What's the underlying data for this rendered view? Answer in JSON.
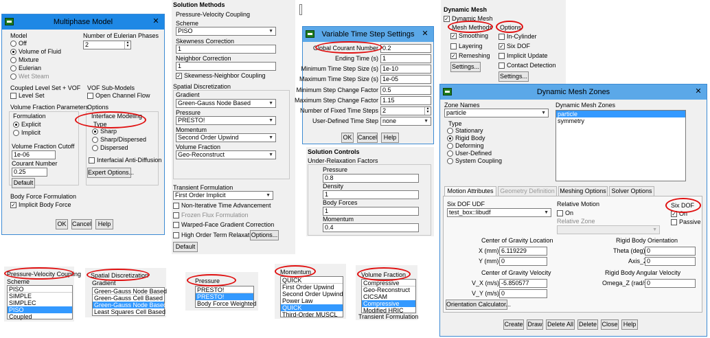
{
  "multiphase": {
    "title": "Multiphase Model",
    "model_label": "Model",
    "models": [
      "Off",
      "Volume of Fluid",
      "Mixture",
      "Eulerian",
      "Wet Steam"
    ],
    "num_phases_label": "Number of Eulerian Phases",
    "num_phases_value": "2",
    "coupled_label": "Coupled Level Set + VOF",
    "level_set": "Level Set",
    "vof_sub_label": "VOF Sub-Models",
    "open_channel": "Open Channel Flow",
    "vf_params_label": "Volume Fraction Parameters",
    "formulation_label": "Formulation",
    "explicit": "Explicit",
    "implicit": "Implicit",
    "options_label": "Options",
    "interface_modeling": "Interface Modeling",
    "type_label": "Type",
    "sharp": "Sharp",
    "sharp_dispersed": "Sharp/Dispersed",
    "dispersed": "Dispersed",
    "anti_diffusion": "Interfacial Anti-Diffusion",
    "cutoff_label": "Volume Fraction Cutoff",
    "cutoff_value": "1e-06",
    "courant_label": "Courant Number",
    "courant_value": "0.25",
    "default_btn": "Default",
    "expert_btn": "Expert Options...",
    "body_force_label": "Body Force Formulation",
    "implicit_body_force": "Implicit Body Force",
    "ok": "OK",
    "cancel": "Cancel",
    "help": "Help"
  },
  "solution_methods": {
    "title": "Solution Methods",
    "pv_coupling": "Pressure-Velocity Coupling",
    "scheme_label": "Scheme",
    "scheme_value": "PISO",
    "skewness_label": "Skewness Correction",
    "skewness_value": "1",
    "neighbor_label": "Neighbor Correction",
    "neighbor_value": "1",
    "skew_neighbor": "Skewness-Neighbor Coupling",
    "spatial_label": "Spatial Discretization",
    "gradient_label": "Gradient",
    "gradient_value": "Green-Gauss Node Based",
    "pressure_label": "Pressure",
    "pressure_value": "PRESTO!",
    "momentum_label": "Momentum",
    "momentum_value": "Second Order Upwind",
    "vf_label": "Volume Fraction",
    "vf_value": "Geo-Reconstruct",
    "transient_label": "Transient Formulation",
    "transient_value": "First Order Implicit",
    "nita": "Non-Iterative Time Advancement",
    "frozen_flux": "Frozen Flux Formulation",
    "warped_face": "Warped-Face Gradient Correction",
    "high_order": "High Order Term Relaxation",
    "options_btn": "Options...",
    "default_btn": "Default"
  },
  "variable_ts": {
    "title": "Variable Time Step Settings",
    "rows": [
      {
        "label": "Global Courant Number",
        "value": "0.2"
      },
      {
        "label": "Ending Time (s)",
        "value": "1"
      },
      {
        "label": "Minimum Time Step Size (s)",
        "value": "1e-10"
      },
      {
        "label": "Maximum Time Step Size (s)",
        "value": "1e-05"
      },
      {
        "label": "Minimum Step Change Factor",
        "value": "0.5"
      },
      {
        "label": "Maximum Step Change Factor",
        "value": "1.15"
      },
      {
        "label": "Number of Fixed Time Steps",
        "value": "2"
      },
      {
        "label": "User-Defined Time Step",
        "value": "none"
      }
    ],
    "ok": "OK",
    "cancel": "Cancel",
    "help": "Help"
  },
  "solution_controls": {
    "title": "Solution Controls",
    "urf_label": "Under-Relaxation Factors",
    "items": [
      {
        "label": "Pressure",
        "value": "0.8"
      },
      {
        "label": "Density",
        "value": "1"
      },
      {
        "label": "Body Forces",
        "value": "1"
      },
      {
        "label": "Momentum",
        "value": "0.4"
      }
    ]
  },
  "dynamic_mesh": {
    "title": "Dynamic Mesh",
    "enable": "Dynamic Mesh",
    "mesh_methods": "Mesh Methods",
    "smoothing": "Smoothing",
    "layering": "Layering",
    "remeshing": "Remeshing",
    "settings_btn": "Settings...",
    "options": "Options",
    "in_cylinder": "In-Cylinder",
    "six_dof": "Six DOF",
    "implicit_update": "Implicit Update",
    "contact_detection": "Contact Detection",
    "settings_btn2": "Settings..."
  },
  "dmz": {
    "title": "Dynamic Mesh Zones",
    "zone_names_label": "Zone Names",
    "zone_name_value": "particle",
    "dm_zones_label": "Dynamic Mesh Zones",
    "zones": [
      "particle",
      "symmetry"
    ],
    "type_label": "Type",
    "types": [
      "Stationary",
      "Rigid Body",
      "Deforming",
      "User-Defined",
      "System Coupling"
    ],
    "tabs": [
      "Motion Attributes",
      "Geometry Definition",
      "Meshing Options",
      "Solver Options"
    ],
    "six_dof_udf_label": "Six DOF UDF",
    "udf_value": "test_box::libudf",
    "relative_motion": "Relative Motion",
    "on": "On",
    "relative_zone": "Relative Zone",
    "six_dof_label": "Six DOF",
    "passive": "Passive",
    "cog_loc_label": "Center of Gravity Location",
    "x_label": "X (mm)",
    "x_value": "6.119229",
    "y_label": "Y (mm)",
    "y_value": "0",
    "rbo_label": "Rigid Body Orientation",
    "theta_label": "Theta (deg)",
    "theta_value": "0",
    "axisz_label": "Axis_Z",
    "axisz_value": "0",
    "cog_vel_label": "Center of Gravity Velocity",
    "vx_label": "V_X (m/s)",
    "vx_value": "-5.850577",
    "vy_label": "V_Y (m/s)",
    "vy_value": "0",
    "rbav_label": "Rigid Body Angular Velocity",
    "omega_label": "Omega_Z (rad/s)",
    "omega_value": "0",
    "orient_btn": "Orientation Calculator...",
    "buttons": [
      "Create",
      "Draw",
      "Delete All",
      "Delete",
      "Close",
      "Help"
    ]
  },
  "snippets": {
    "pvc": {
      "header": "Pressure-Velocity Coupling",
      "scheme": "Scheme",
      "items": [
        "PISO",
        "SIMPLE",
        "SIMPLEC",
        "PISO",
        "Coupled"
      ]
    },
    "sd": {
      "header": "Spatial Discretization",
      "gradient": "Gradient",
      "items": [
        "Green-Gauss Node Based",
        "Green-Gauss Cell Based",
        "Green-Gauss Node Based",
        "Least Squares Cell Based"
      ]
    },
    "pres": {
      "header": "Pressure",
      "items": [
        "PRESTO!",
        "PRESTO!",
        "Body Force Weighted"
      ]
    },
    "mom": {
      "header": "Momentum",
      "items": [
        "QUICK",
        "First Order Upwind",
        "Second Order Upwind",
        "Power Law",
        "QUICK",
        "Third-Order MUSCL"
      ]
    },
    "vfrac": {
      "header": "Volume Fraction",
      "items": [
        "Compressive",
        "Geo-Reconstruct",
        "CICSAM",
        "Compressive",
        "Modified HRIC",
        "Transient Formulation"
      ]
    }
  }
}
